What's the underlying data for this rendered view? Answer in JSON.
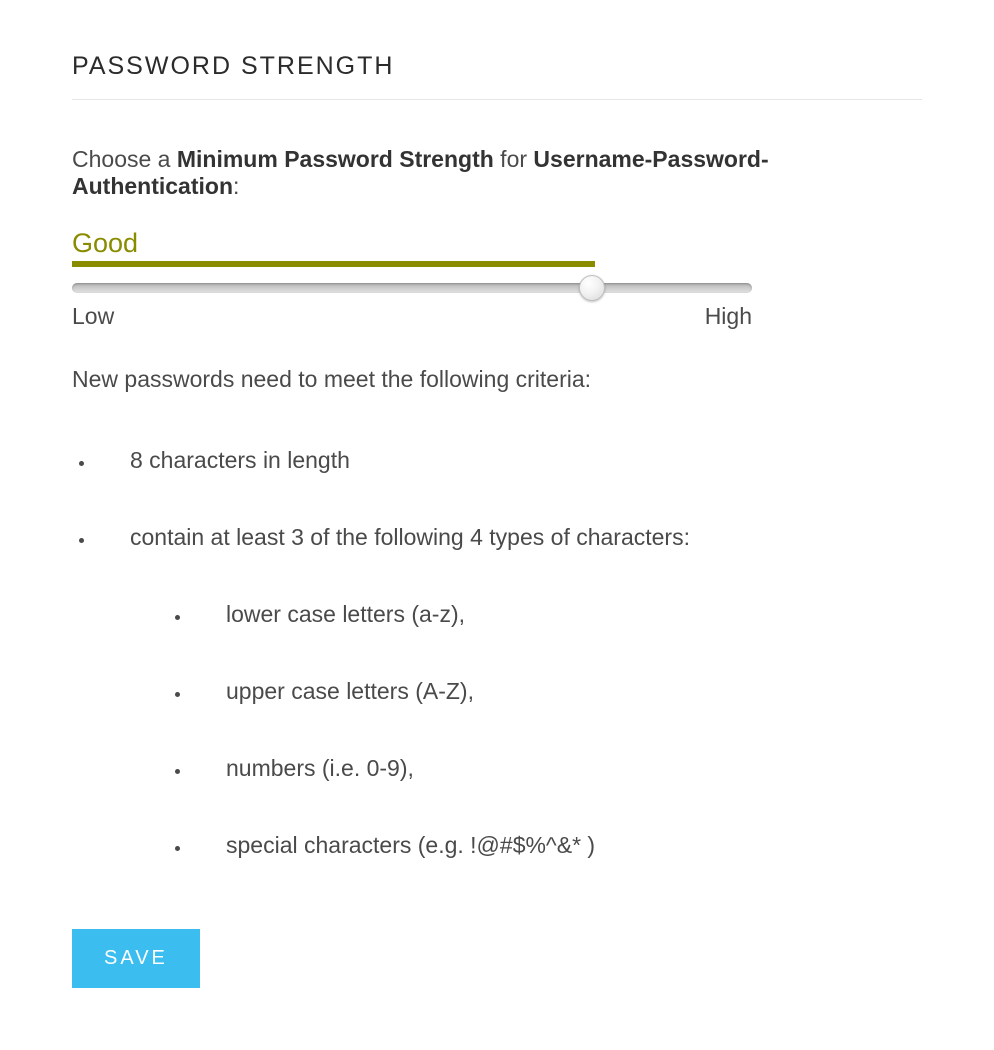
{
  "section_title": "PASSWORD STRENGTH",
  "instruction": {
    "prefix": "Choose a ",
    "bold1": "Minimum Password Strength",
    "middle": " for ",
    "bold2": "Username-Password-Authentication",
    "suffix": ":"
  },
  "strength": {
    "current_label": "Good",
    "fill_percent": 61.5,
    "thumb_percent": 76.5,
    "low_label": "Low",
    "high_label": "High",
    "accent_color": "#8a8c00"
  },
  "criteria_intro": "New passwords need to meet the following criteria:",
  "criteria": [
    {
      "text": "8 characters in length"
    },
    {
      "text": "contain at least 3 of the following 4 types of characters:",
      "subitems": [
        "lower case letters (a-z),",
        "upper case letters (A-Z),",
        "numbers (i.e. 0-9),",
        "special characters (e.g. !@#$%^&* )"
      ]
    }
  ],
  "save_label": "SAVE",
  "colors": {
    "button_bg": "#3bbeef"
  }
}
